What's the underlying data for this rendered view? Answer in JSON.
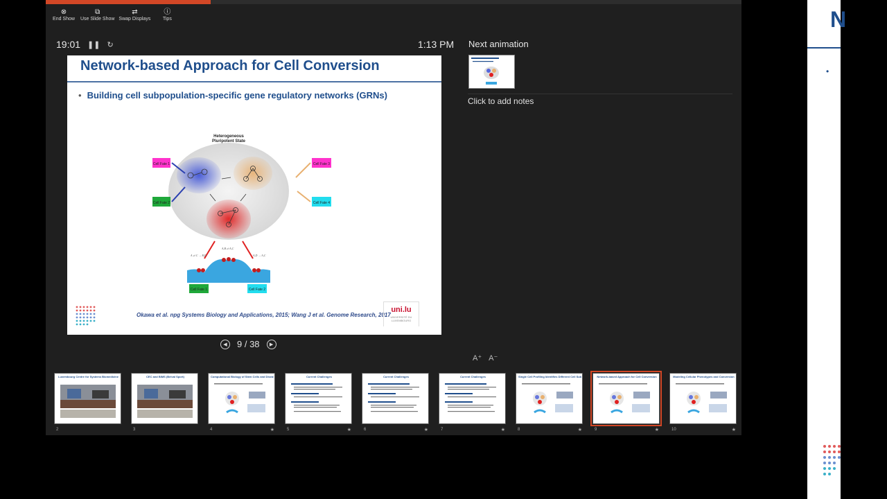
{
  "toolbar": [
    {
      "label": "End Show",
      "icon": "close-circle-icon",
      "glyph": "⊗"
    },
    {
      "label": "Use Slide Show",
      "icon": "monitor-icon",
      "glyph": "⧉"
    },
    {
      "label": "Swap Displays",
      "icon": "swap-icon",
      "glyph": "⇄"
    },
    {
      "label": "Tips",
      "icon": "info-icon",
      "glyph": "ⓘ"
    }
  ],
  "timer": {
    "elapsed": "19:01",
    "pause_glyph": "❚❚",
    "reset_glyph": "↻"
  },
  "clock": "1:13 PM",
  "progress": {
    "fraction": 0.237
  },
  "slide": {
    "title": "Network-based Approach for Cell Conversion",
    "bullet": "Building cell subpopulation-specific gene regulatory networks (GRNs)",
    "figure": {
      "heading_1": "Heterogeneous",
      "heading_2": "Pluripotent State",
      "labels": [
        "Cell Fate 1",
        "Cell Fate 2",
        "Cell Fate 3",
        "Cell Fate 4"
      ],
      "bottom_labels": [
        "Cell Fate 1",
        "Cell Fate 2"
      ],
      "annotations": [
        "A ⇌ C → B,D",
        "A,B ⇌ A,C",
        "A,D → A,C"
      ],
      "colors": {
        "blue": "#3a4fd6",
        "red": "#e02020",
        "orange": "#e8b070",
        "magenta": "#ff33cc",
        "green": "#1fa83a",
        "cyan": "#22ddee",
        "hill": "#3aa6e0"
      }
    },
    "reference": "Okawa et al. npg Systems Biology and Applications, 2015; Wang J et al. Genome Research, 2017",
    "uni_logo_main": "uni.lu",
    "uni_logo_sub": "UNIVERSITÉ DU LUXEMBOURG"
  },
  "navigation": {
    "counter": "9 / 38",
    "prev_glyph": "◀",
    "next_glyph": "▶"
  },
  "next_panel": {
    "label": "Next animation",
    "notes_placeholder": "Click to add notes",
    "font_increase": "A⁺",
    "font_decrease": "A⁻"
  },
  "thumbnails": [
    {
      "num": "2",
      "title": "Luxembourg Centre for Systems Biomedicine",
      "kind": "photo",
      "star": false
    },
    {
      "num": "3",
      "title": "CEC and BiMS (Belval Sport)",
      "kind": "photo",
      "star": false
    },
    {
      "num": "4",
      "title": "Computational Biology of Stem Cells and Disease Modeling",
      "kind": "diagram",
      "star": true
    },
    {
      "num": "5",
      "title": "Current Challenges",
      "kind": "text",
      "star": true
    },
    {
      "num": "6",
      "title": "Current Challenges",
      "kind": "text",
      "star": true
    },
    {
      "num": "7",
      "title": "Current Challenges",
      "kind": "text",
      "star": true
    },
    {
      "num": "8",
      "title": "Single Cell Profiling Identifies Different Cell Subpopulations",
      "kind": "diagram",
      "star": true
    },
    {
      "num": "9",
      "title": "Network-based Approach for Cell Conversion",
      "kind": "diagram",
      "star": true,
      "active": true
    },
    {
      "num": "10",
      "title": "Modeling Cellular Phenotypes and Conversion",
      "kind": "diagram",
      "star": true
    }
  ],
  "side_window": {
    "letter": "N",
    "bullet": "•"
  }
}
